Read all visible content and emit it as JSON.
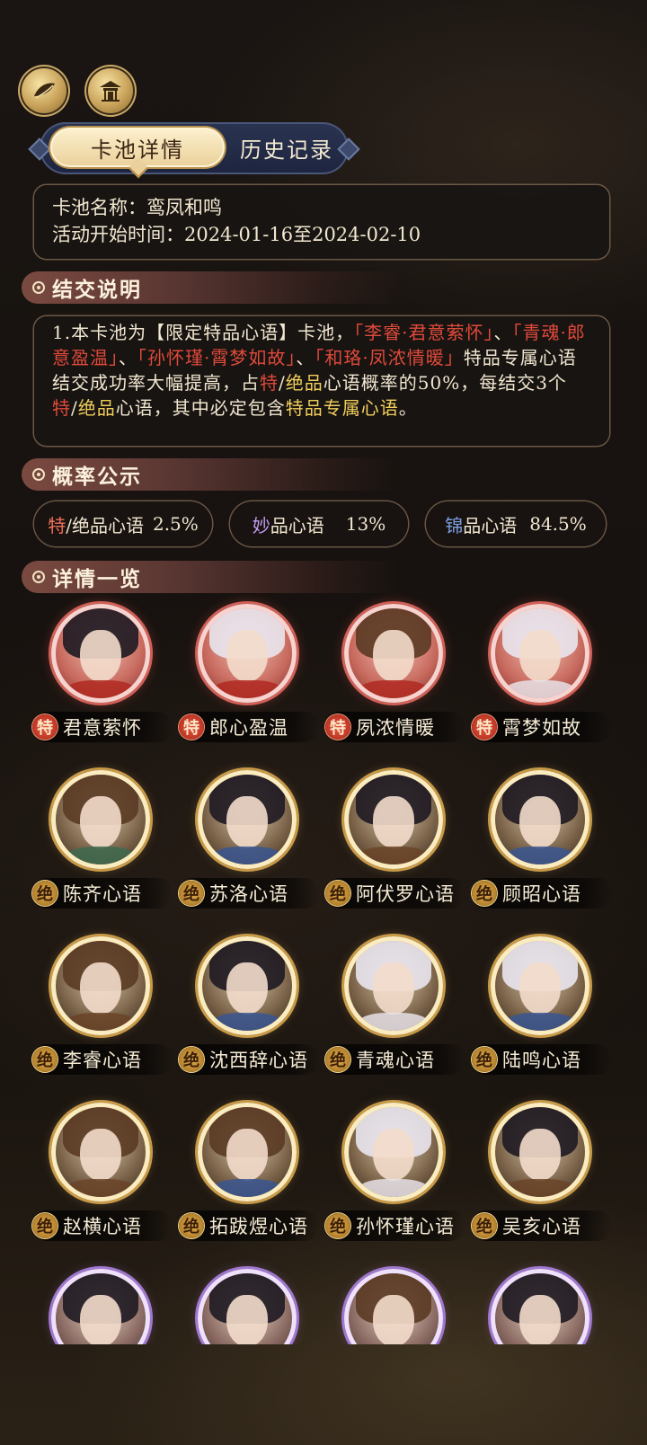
{
  "top_icons": [
    "leaf-emblem-icon",
    "pavilion-icon"
  ],
  "tabs": {
    "active": "卡池详情",
    "inactive": "历史记录"
  },
  "pool_info": {
    "name_line": "卡池名称：鸾凤和鸣",
    "time_line": "活动开始时间：2024-01-16至2024-02-10"
  },
  "sections": {
    "description": "结交说明",
    "probability": "概率公示",
    "details": "详情一览"
  },
  "description": {
    "p1": "1.本卡池为【限定特品心语】卡池，",
    "r1": "「李睿·君意萦怀」",
    "p2": "、",
    "r2": "「青魂·郎意盈温」",
    "p3": "、",
    "r3": "「孙怀瑾·霄梦如故」",
    "p4": "、",
    "r4": "「和珞·凤浓情暖」",
    "p5": "特品专属心语结交成功率大幅提高，占",
    "r5": "特",
    "p6": "/",
    "g1": "绝品",
    "p7": "心语概率的50%，每结交3个",
    "r6": "特",
    "p8": "/",
    "g2": "绝品",
    "p9": "心语，其中必定包含",
    "g3": "特品专属心语",
    "p10": "。"
  },
  "probabilities": [
    {
      "prefix": "特",
      "sep": "/绝品心语",
      "value": "2.5%"
    },
    {
      "prefix": "妙",
      "sep": "品心语",
      "value": "13%"
    },
    {
      "prefix": "锦",
      "sep": "品心语",
      "value": "84.5%"
    }
  ],
  "grid": [
    {
      "badge": "特",
      "name": "君意萦怀"
    },
    {
      "badge": "特",
      "name": "郎心盈温"
    },
    {
      "badge": "特",
      "name": "夙浓情暖"
    },
    {
      "badge": "特",
      "name": "霄梦如故"
    },
    {
      "badge": "绝",
      "name": "陈齐心语"
    },
    {
      "badge": "绝",
      "name": "苏洛心语"
    },
    {
      "badge": "绝",
      "name": "阿伏罗心语"
    },
    {
      "badge": "绝",
      "name": "顾昭心语"
    },
    {
      "badge": "绝",
      "name": "李睿心语"
    },
    {
      "badge": "绝",
      "name": "沈西辞心语"
    },
    {
      "badge": "绝",
      "name": "青魂心语"
    },
    {
      "badge": "绝",
      "name": "陆鸣心语"
    },
    {
      "badge": "绝",
      "name": "赵横心语"
    },
    {
      "badge": "绝",
      "name": "拓跋煜心语"
    },
    {
      "badge": "绝",
      "name": "孙怀瑾心语"
    },
    {
      "badge": "绝",
      "name": "吴亥心语"
    }
  ]
}
